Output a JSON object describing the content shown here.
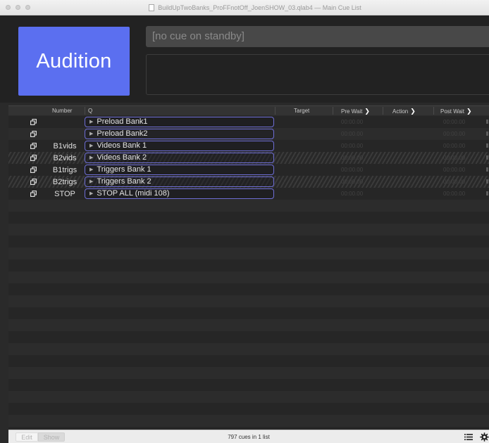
{
  "window": {
    "title": "BuildUpTwoBanks_ProFFnotOff_JoenSHOW_03.qlab4 — Main Cue List"
  },
  "go_button": {
    "label": "Audition",
    "color": "#5b6ff0"
  },
  "standby": {
    "text": "[no cue on standby]"
  },
  "table": {
    "headers": {
      "number": "Number",
      "q": "Q",
      "target": "Target",
      "pre_wait": "Pre Wait",
      "action": "Action",
      "post_wait": "Post Wait"
    },
    "rows": [
      {
        "icon": "group-cue-icon",
        "number": "",
        "name": "Preload Bank1",
        "pre_wait": "00:00.00",
        "post_wait": "00:00.00",
        "state": "normal"
      },
      {
        "icon": "group-cue-icon",
        "number": "",
        "name": "Preload Bank2",
        "pre_wait": "00:00.00",
        "post_wait": "00:00.00",
        "state": "normal"
      },
      {
        "icon": "group-cue-icon",
        "number": "B1vids",
        "name": "Videos Bank 1",
        "pre_wait": "00:00.00",
        "post_wait": "00:00.00",
        "state": "normal"
      },
      {
        "icon": "group-cue-icon",
        "number": "B2vids",
        "name": "Videos Bank 2",
        "pre_wait": "00:00.00",
        "post_wait": "00:00.00",
        "state": "disarmed"
      },
      {
        "icon": "group-cue-icon",
        "number": "B1trigs",
        "name": "Triggers Bank 1",
        "pre_wait": "00:00.00",
        "post_wait": "00:00.00",
        "state": "normal"
      },
      {
        "icon": "group-cue-icon",
        "number": "B2trigs",
        "name": "Triggers Bank 2",
        "pre_wait": "00:00.00",
        "post_wait": "00:00.00",
        "state": "disarmed"
      },
      {
        "icon": "group-cue-icon",
        "number": "STOP",
        "name": "STOP ALL (midi 108)",
        "pre_wait": "00:00.00",
        "post_wait": "00:00.00",
        "state": "normal"
      }
    ]
  },
  "footer": {
    "mode_edit": "Edit",
    "mode_show": "Show",
    "cue_count": "797 cues in 1 list",
    "list_icon": "list-icon",
    "settings_icon": "gear-icon"
  }
}
